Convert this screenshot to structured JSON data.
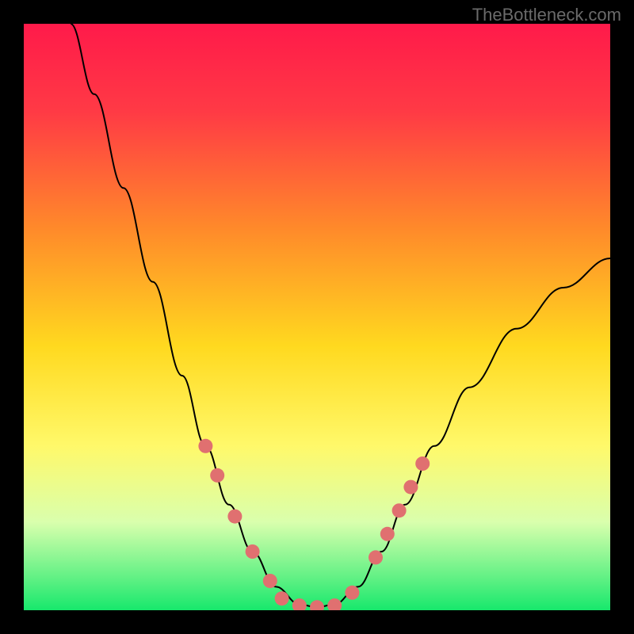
{
  "watermark": "TheBottleneck.com",
  "chart_data": {
    "type": "line",
    "title": "",
    "xlabel": "",
    "ylabel": "",
    "xlim": [
      0,
      100
    ],
    "ylim": [
      0,
      100
    ],
    "background_gradient": {
      "stops": [
        {
          "offset": 0.0,
          "color": "#ff1a4a"
        },
        {
          "offset": 0.15,
          "color": "#ff3a45"
        },
        {
          "offset": 0.35,
          "color": "#ff8a2a"
        },
        {
          "offset": 0.55,
          "color": "#ffd91f"
        },
        {
          "offset": 0.72,
          "color": "#fff96a"
        },
        {
          "offset": 0.85,
          "color": "#d9ffad"
        },
        {
          "offset": 0.95,
          "color": "#5af082"
        },
        {
          "offset": 1.0,
          "color": "#17e86c"
        }
      ]
    },
    "series": [
      {
        "name": "bottleneck-curve",
        "type": "line",
        "color": "#000000",
        "width": 2,
        "points": [
          {
            "x": 8,
            "y": 100
          },
          {
            "x": 12,
            "y": 88
          },
          {
            "x": 17,
            "y": 72
          },
          {
            "x": 22,
            "y": 56
          },
          {
            "x": 27,
            "y": 40
          },
          {
            "x": 31,
            "y": 28
          },
          {
            "x": 35,
            "y": 18
          },
          {
            "x": 39,
            "y": 10
          },
          {
            "x": 43,
            "y": 4
          },
          {
            "x": 47,
            "y": 1
          },
          {
            "x": 50,
            "y": 0.5
          },
          {
            "x": 53,
            "y": 1
          },
          {
            "x": 57,
            "y": 4
          },
          {
            "x": 61,
            "y": 10
          },
          {
            "x": 65,
            "y": 18
          },
          {
            "x": 70,
            "y": 28
          },
          {
            "x": 76,
            "y": 38
          },
          {
            "x": 84,
            "y": 48
          },
          {
            "x": 92,
            "y": 55
          },
          {
            "x": 100,
            "y": 60
          }
        ]
      },
      {
        "name": "data-points",
        "type": "scatter",
        "color": "#e07070",
        "radius": 9,
        "points": [
          {
            "x": 31,
            "y": 28
          },
          {
            "x": 33,
            "y": 23
          },
          {
            "x": 36,
            "y": 16
          },
          {
            "x": 39,
            "y": 10
          },
          {
            "x": 42,
            "y": 5
          },
          {
            "x": 44,
            "y": 2
          },
          {
            "x": 47,
            "y": 0.8
          },
          {
            "x": 50,
            "y": 0.5
          },
          {
            "x": 53,
            "y": 0.8
          },
          {
            "x": 56,
            "y": 3
          },
          {
            "x": 60,
            "y": 9
          },
          {
            "x": 62,
            "y": 13
          },
          {
            "x": 64,
            "y": 17
          },
          {
            "x": 66,
            "y": 21
          },
          {
            "x": 68,
            "y": 25
          }
        ]
      }
    ]
  }
}
